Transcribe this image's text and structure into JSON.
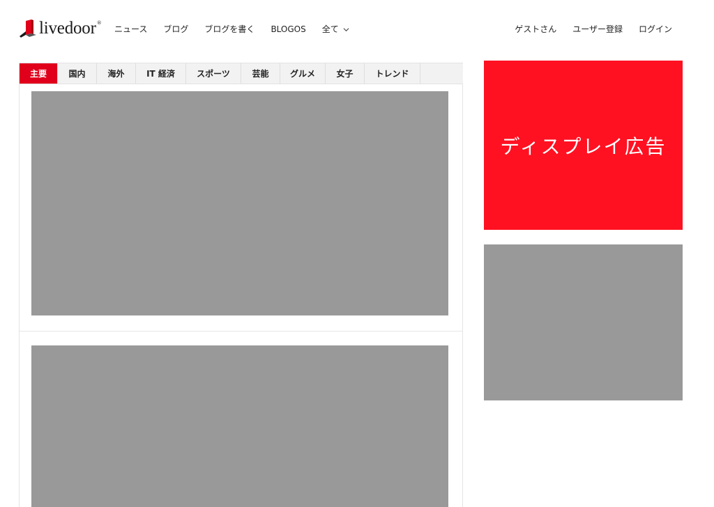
{
  "header": {
    "logo_text": "livedoor",
    "logo_reg": "®",
    "brand_color": "#e0001b",
    "nav": [
      {
        "label": "ニュース"
      },
      {
        "label": "ブログ"
      },
      {
        "label": "ブログを書く"
      },
      {
        "label": "BLOGOS"
      },
      {
        "label": "全て",
        "icon": "chevron-down-icon"
      }
    ],
    "user_links": [
      {
        "label": "ゲストさん"
      },
      {
        "label": "ユーザー登録"
      },
      {
        "label": "ログイン"
      }
    ]
  },
  "tabs": [
    {
      "label": "主要",
      "active": true
    },
    {
      "label": "国内"
    },
    {
      "label": "海外"
    },
    {
      "label": "IT 経済"
    },
    {
      "label": "スポーツ"
    },
    {
      "label": "芸能"
    },
    {
      "label": "グルメ"
    },
    {
      "label": "女子"
    },
    {
      "label": "トレンド"
    }
  ],
  "sidebar": {
    "display_ad_label": "ディスプレイ広告",
    "display_ad_color": "#ff1122",
    "placeholder_color": "#999999"
  }
}
